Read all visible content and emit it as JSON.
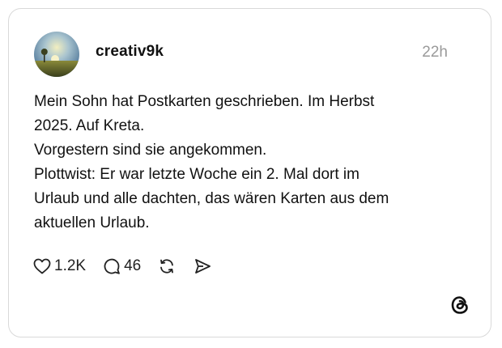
{
  "post": {
    "username": "creativ9k",
    "time": "22h",
    "lines": [
      "Mein Sohn hat Postkarten geschrieben. Im Herbst",
      "2025. Auf Kreta.",
      "Vorgestern sind sie angekommen.",
      "Plottwist: Er war letzte Woche ein 2. Mal dort im",
      "Urlaub und alle dachten, das wären Karten aus dem",
      "aktuellen Urlaub."
    ]
  },
  "actions": {
    "likes": "1.2K",
    "comments": "46"
  },
  "icons": {
    "like": "heart-icon",
    "comment": "comment-bubble-icon",
    "repost": "repost-icon",
    "share": "send-icon",
    "brand": "threads-logo-icon"
  }
}
